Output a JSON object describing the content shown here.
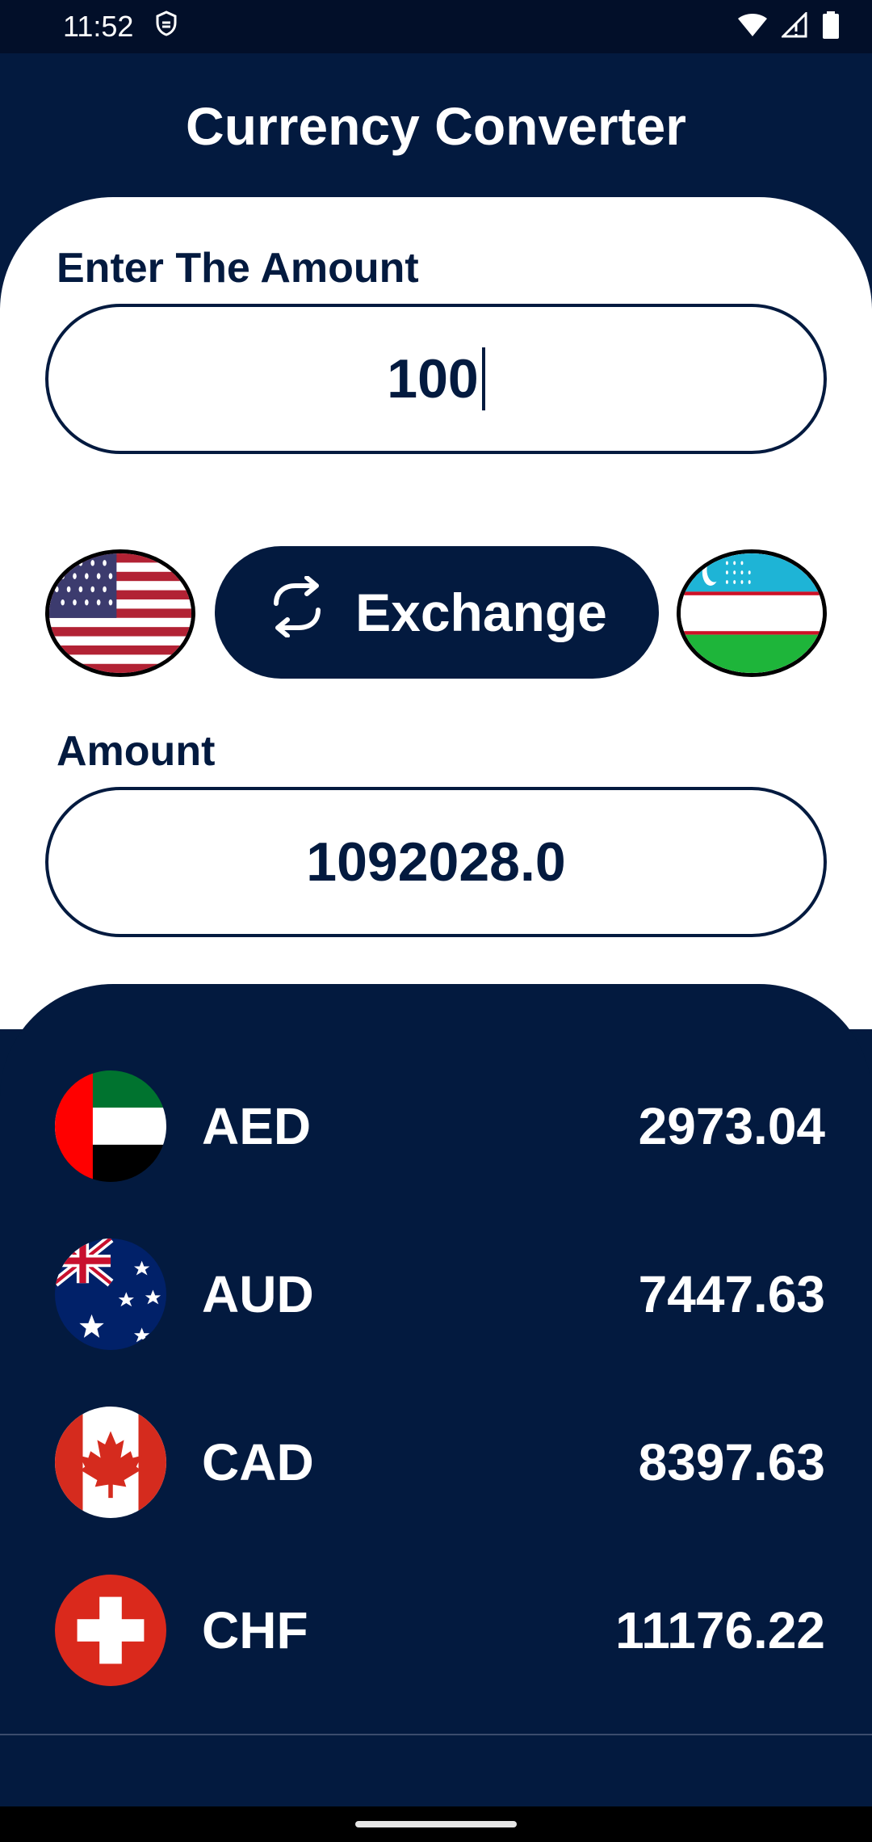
{
  "status_bar": {
    "time": "11:52"
  },
  "header": {
    "title": "Currency Converter"
  },
  "input": {
    "label": "Enter The Amount",
    "value": "100"
  },
  "exchange": {
    "label": "Exchange",
    "from_flag": "us-flag",
    "to_flag": "uz-flag"
  },
  "result": {
    "label": "Amount",
    "value": "1092028.0"
  },
  "rates": [
    {
      "code": "AED",
      "value": "2973.04",
      "flag": "ae-flag"
    },
    {
      "code": "AUD",
      "value": "7447.63",
      "flag": "au-flag"
    },
    {
      "code": "CAD",
      "value": "8397.63",
      "flag": "ca-flag"
    },
    {
      "code": "CHF",
      "value": "11176.22",
      "flag": "ch-flag"
    }
  ],
  "colors": {
    "navy": "#031a3f",
    "white": "#ffffff"
  }
}
